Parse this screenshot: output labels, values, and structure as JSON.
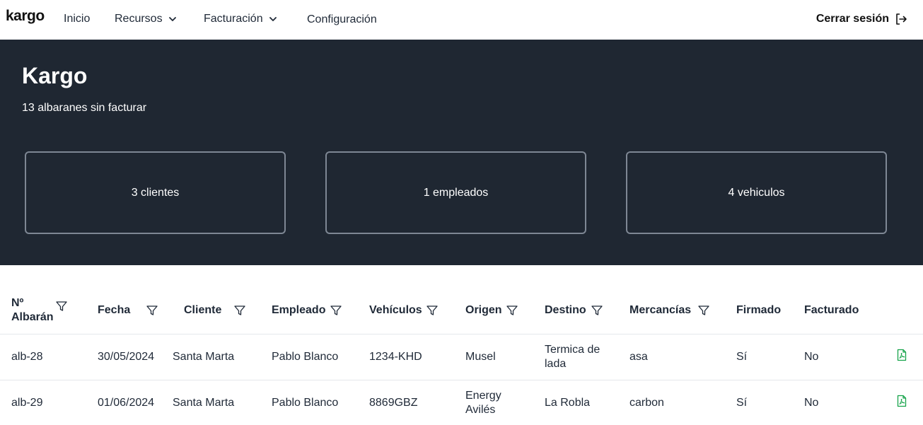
{
  "nav": {
    "logo": "kargo",
    "items": [
      {
        "label": "Inicio",
        "has_dropdown": false
      },
      {
        "label": "Recursos",
        "has_dropdown": true
      },
      {
        "label": "Facturación",
        "has_dropdown": true
      },
      {
        "label": "Configuración",
        "has_dropdown": false
      }
    ],
    "logout_label": "Cerrar sesión",
    "logout_icon": "logout-icon"
  },
  "hero": {
    "title": "Kargo",
    "subtitle": "13 albaranes sin facturar",
    "background": "#1f2732",
    "cards": [
      {
        "label": "3 clientes"
      },
      {
        "label": "1 empleados"
      },
      {
        "label": "4 vehiculos"
      }
    ]
  },
  "table": {
    "columns": [
      {
        "label": "Nº Albarán",
        "filter": true
      },
      {
        "label": "Fecha",
        "filter": true
      },
      {
        "label": "Cliente",
        "filter": true
      },
      {
        "label": "Empleado",
        "filter": true
      },
      {
        "label": "Vehículos",
        "filter": true
      },
      {
        "label": "Origen",
        "filter": true
      },
      {
        "label": "Destino",
        "filter": true
      },
      {
        "label": "Mercancías",
        "filter": true
      },
      {
        "label": "Firmado",
        "filter": false
      },
      {
        "label": "Facturado",
        "filter": false
      },
      {
        "label": "",
        "filter": false
      }
    ],
    "rows": [
      [
        "alb-28",
        "30/05/2024",
        "Santa Marta",
        "Pablo Blanco",
        "1234-KHD",
        "Musel",
        "Termica de lada",
        "asa",
        "Sí",
        "No"
      ],
      [
        "alb-29",
        "01/06/2024",
        "Santa Marta",
        "Pablo Blanco",
        "8869GBZ",
        "Energy Avilés",
        "La Robla",
        "carbon",
        "Sí",
        "No"
      ]
    ],
    "row_action_icon": "pdf-file-icon",
    "accent_color": "#16a34a"
  }
}
